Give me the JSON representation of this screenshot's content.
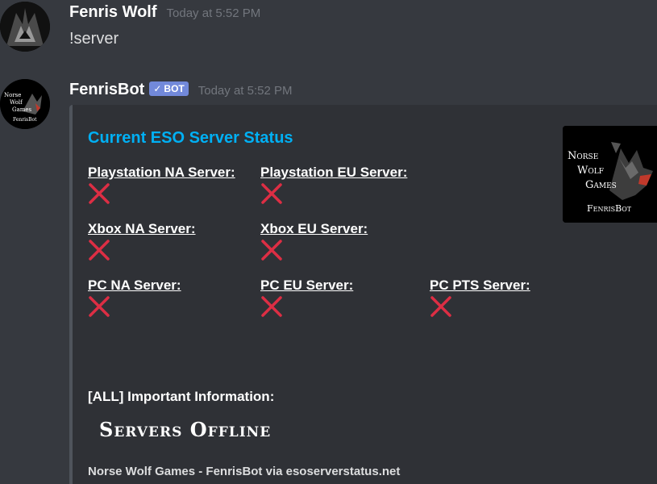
{
  "messages": [
    {
      "author": "Fenris Wolf",
      "timestamp": "Today at 5:52 PM",
      "content": "!server"
    },
    {
      "author": "FenrisBot",
      "bot_tag": "BOT",
      "timestamp": "Today at 5:52 PM",
      "avatar_text": [
        "Norse",
        "Wolf",
        "Games",
        "FenrisBot"
      ],
      "embed": {
        "title": "Current ESO Server Status",
        "fields": [
          {
            "name": "Playstation NA Server:",
            "status": "offline"
          },
          {
            "name": "Playstation EU Server:",
            "status": "offline"
          },
          {
            "name": "Xbox NA Server:",
            "status": "offline"
          },
          {
            "name": "Xbox EU Server:",
            "status": "offline"
          },
          {
            "name": "PC NA Server:",
            "status": "offline"
          },
          {
            "name": "PC EU Server:",
            "status": "offline"
          },
          {
            "name": "PC PTS Server:",
            "status": "offline"
          }
        ],
        "info_name": "[ALL] Important Information:",
        "info_image_text": "Servers Offline",
        "footer": "Norse Wolf Games - FenrisBot via esoserverstatus.net",
        "thumbnail_text": [
          "Norse",
          "Wolf",
          "Games",
          "FenrisBot"
        ]
      }
    }
  ],
  "colors": {
    "background": "#36393f",
    "embed_bg": "#2f3136",
    "embed_title": "#00b0f4",
    "bot_tag": "#7289da",
    "status_offline": "#dd2e44"
  },
  "icons": {
    "status_offline": "cross-mark-icon",
    "bot_check": "checkmark-icon"
  }
}
